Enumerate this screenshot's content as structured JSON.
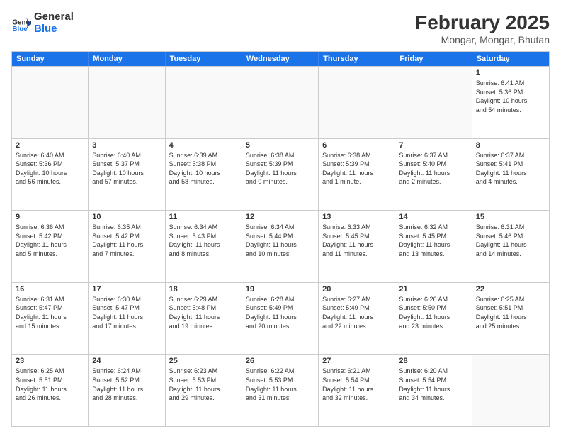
{
  "logo": {
    "line1": "General",
    "line2": "Blue"
  },
  "title": "February 2025",
  "subtitle": "Mongar, Mongar, Bhutan",
  "weekdays": [
    "Sunday",
    "Monday",
    "Tuesday",
    "Wednesday",
    "Thursday",
    "Friday",
    "Saturday"
  ],
  "weeks": [
    [
      {
        "day": "",
        "info": ""
      },
      {
        "day": "",
        "info": ""
      },
      {
        "day": "",
        "info": ""
      },
      {
        "day": "",
        "info": ""
      },
      {
        "day": "",
        "info": ""
      },
      {
        "day": "",
        "info": ""
      },
      {
        "day": "1",
        "info": "Sunrise: 6:41 AM\nSunset: 5:36 PM\nDaylight: 10 hours\nand 54 minutes."
      }
    ],
    [
      {
        "day": "2",
        "info": "Sunrise: 6:40 AM\nSunset: 5:36 PM\nDaylight: 10 hours\nand 56 minutes."
      },
      {
        "day": "3",
        "info": "Sunrise: 6:40 AM\nSunset: 5:37 PM\nDaylight: 10 hours\nand 57 minutes."
      },
      {
        "day": "4",
        "info": "Sunrise: 6:39 AM\nSunset: 5:38 PM\nDaylight: 10 hours\nand 58 minutes."
      },
      {
        "day": "5",
        "info": "Sunrise: 6:38 AM\nSunset: 5:39 PM\nDaylight: 11 hours\nand 0 minutes."
      },
      {
        "day": "6",
        "info": "Sunrise: 6:38 AM\nSunset: 5:39 PM\nDaylight: 11 hours\nand 1 minute."
      },
      {
        "day": "7",
        "info": "Sunrise: 6:37 AM\nSunset: 5:40 PM\nDaylight: 11 hours\nand 2 minutes."
      },
      {
        "day": "8",
        "info": "Sunrise: 6:37 AM\nSunset: 5:41 PM\nDaylight: 11 hours\nand 4 minutes."
      }
    ],
    [
      {
        "day": "9",
        "info": "Sunrise: 6:36 AM\nSunset: 5:42 PM\nDaylight: 11 hours\nand 5 minutes."
      },
      {
        "day": "10",
        "info": "Sunrise: 6:35 AM\nSunset: 5:42 PM\nDaylight: 11 hours\nand 7 minutes."
      },
      {
        "day": "11",
        "info": "Sunrise: 6:34 AM\nSunset: 5:43 PM\nDaylight: 11 hours\nand 8 minutes."
      },
      {
        "day": "12",
        "info": "Sunrise: 6:34 AM\nSunset: 5:44 PM\nDaylight: 11 hours\nand 10 minutes."
      },
      {
        "day": "13",
        "info": "Sunrise: 6:33 AM\nSunset: 5:45 PM\nDaylight: 11 hours\nand 11 minutes."
      },
      {
        "day": "14",
        "info": "Sunrise: 6:32 AM\nSunset: 5:45 PM\nDaylight: 11 hours\nand 13 minutes."
      },
      {
        "day": "15",
        "info": "Sunrise: 6:31 AM\nSunset: 5:46 PM\nDaylight: 11 hours\nand 14 minutes."
      }
    ],
    [
      {
        "day": "16",
        "info": "Sunrise: 6:31 AM\nSunset: 5:47 PM\nDaylight: 11 hours\nand 15 minutes."
      },
      {
        "day": "17",
        "info": "Sunrise: 6:30 AM\nSunset: 5:47 PM\nDaylight: 11 hours\nand 17 minutes."
      },
      {
        "day": "18",
        "info": "Sunrise: 6:29 AM\nSunset: 5:48 PM\nDaylight: 11 hours\nand 19 minutes."
      },
      {
        "day": "19",
        "info": "Sunrise: 6:28 AM\nSunset: 5:49 PM\nDaylight: 11 hours\nand 20 minutes."
      },
      {
        "day": "20",
        "info": "Sunrise: 6:27 AM\nSunset: 5:49 PM\nDaylight: 11 hours\nand 22 minutes."
      },
      {
        "day": "21",
        "info": "Sunrise: 6:26 AM\nSunset: 5:50 PM\nDaylight: 11 hours\nand 23 minutes."
      },
      {
        "day": "22",
        "info": "Sunrise: 6:25 AM\nSunset: 5:51 PM\nDaylight: 11 hours\nand 25 minutes."
      }
    ],
    [
      {
        "day": "23",
        "info": "Sunrise: 6:25 AM\nSunset: 5:51 PM\nDaylight: 11 hours\nand 26 minutes."
      },
      {
        "day": "24",
        "info": "Sunrise: 6:24 AM\nSunset: 5:52 PM\nDaylight: 11 hours\nand 28 minutes."
      },
      {
        "day": "25",
        "info": "Sunrise: 6:23 AM\nSunset: 5:53 PM\nDaylight: 11 hours\nand 29 minutes."
      },
      {
        "day": "26",
        "info": "Sunrise: 6:22 AM\nSunset: 5:53 PM\nDaylight: 11 hours\nand 31 minutes."
      },
      {
        "day": "27",
        "info": "Sunrise: 6:21 AM\nSunset: 5:54 PM\nDaylight: 11 hours\nand 32 minutes."
      },
      {
        "day": "28",
        "info": "Sunrise: 6:20 AM\nSunset: 5:54 PM\nDaylight: 11 hours\nand 34 minutes."
      },
      {
        "day": "",
        "info": ""
      }
    ]
  ]
}
